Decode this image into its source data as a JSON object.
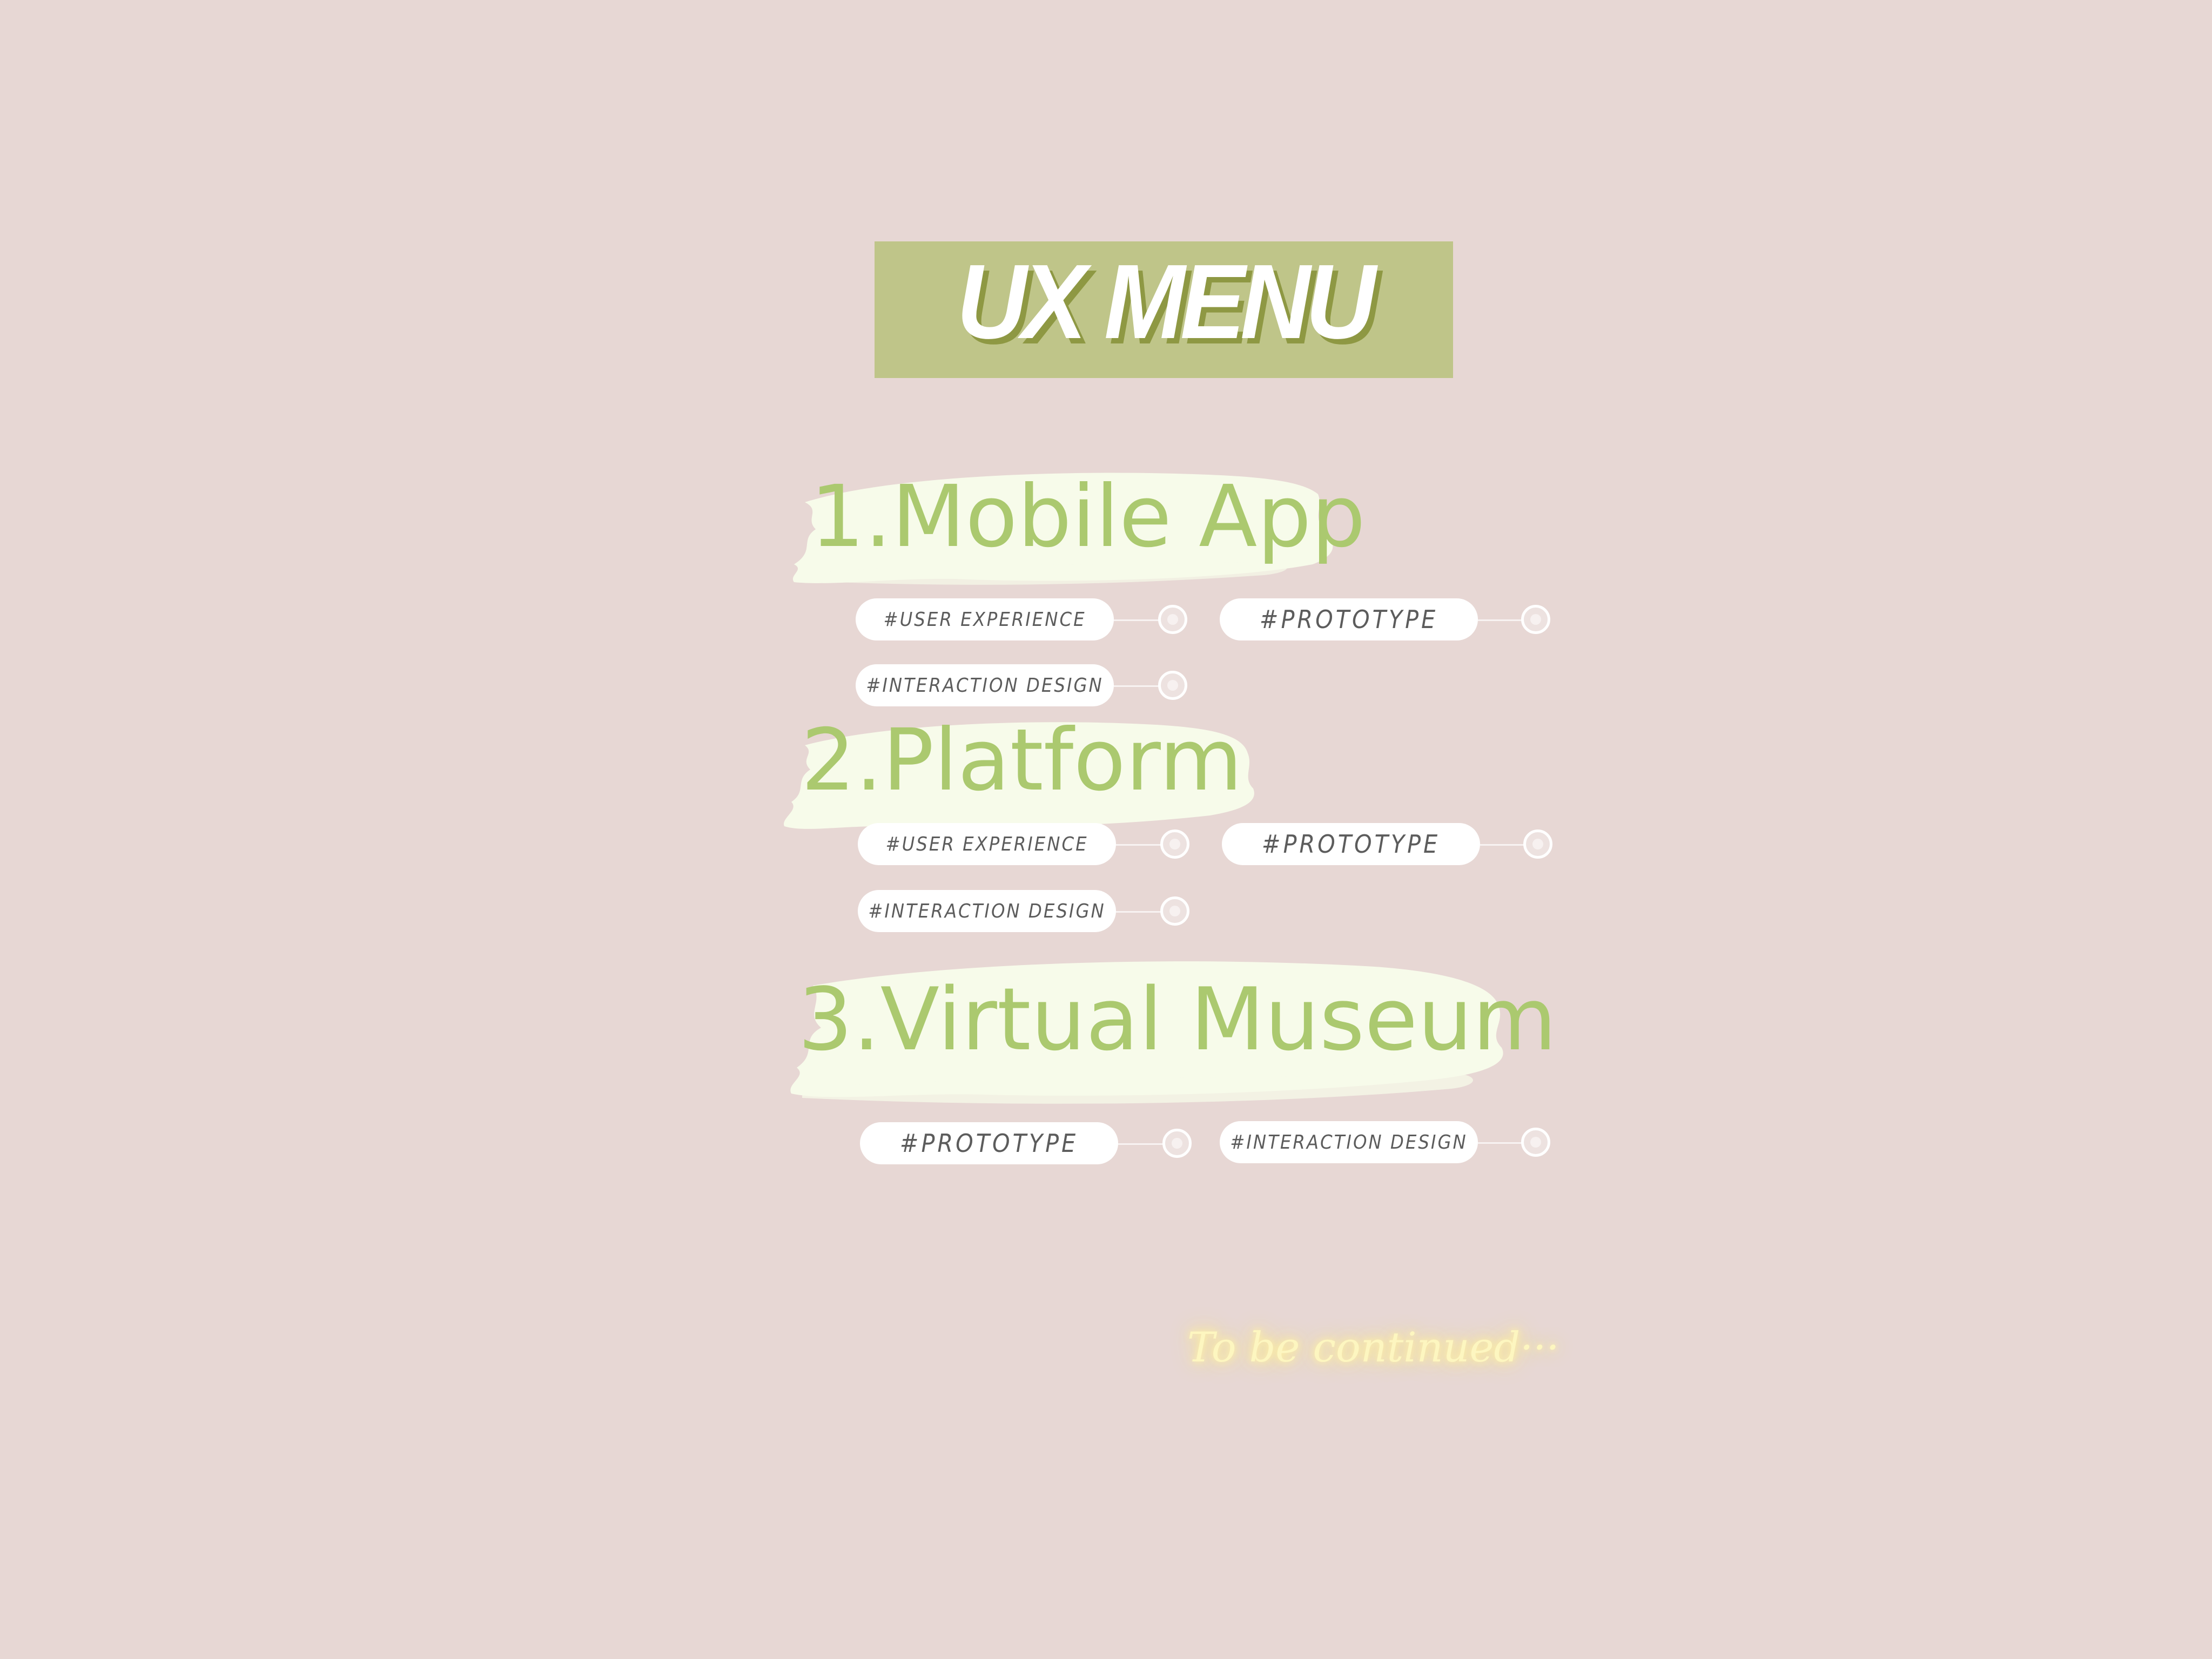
{
  "title": "UX MENU",
  "sections": [
    {
      "heading": "1.Mobile App",
      "tags": [
        "#USER EXPERIENCE",
        "#PROTOTYPE",
        "#INTERACTION DESIGN"
      ]
    },
    {
      "heading": "2.Platform",
      "tags": [
        "#USER EXPERIENCE",
        "#PROTOTYPE",
        "#INTERACTION DESIGN"
      ]
    },
    {
      "heading": "3.Virtual Museum",
      "tags": [
        "#PROTOTYPE",
        "#INTERACTION DESIGN"
      ]
    }
  ],
  "footer": "To be continued···",
  "colors": {
    "background": "#e7d7d4",
    "banner": "#bfc589",
    "heading": "#abc96f",
    "brush": "#f7fbea",
    "tag": "#ffffff",
    "footer_glow": "#fbe98f"
  }
}
